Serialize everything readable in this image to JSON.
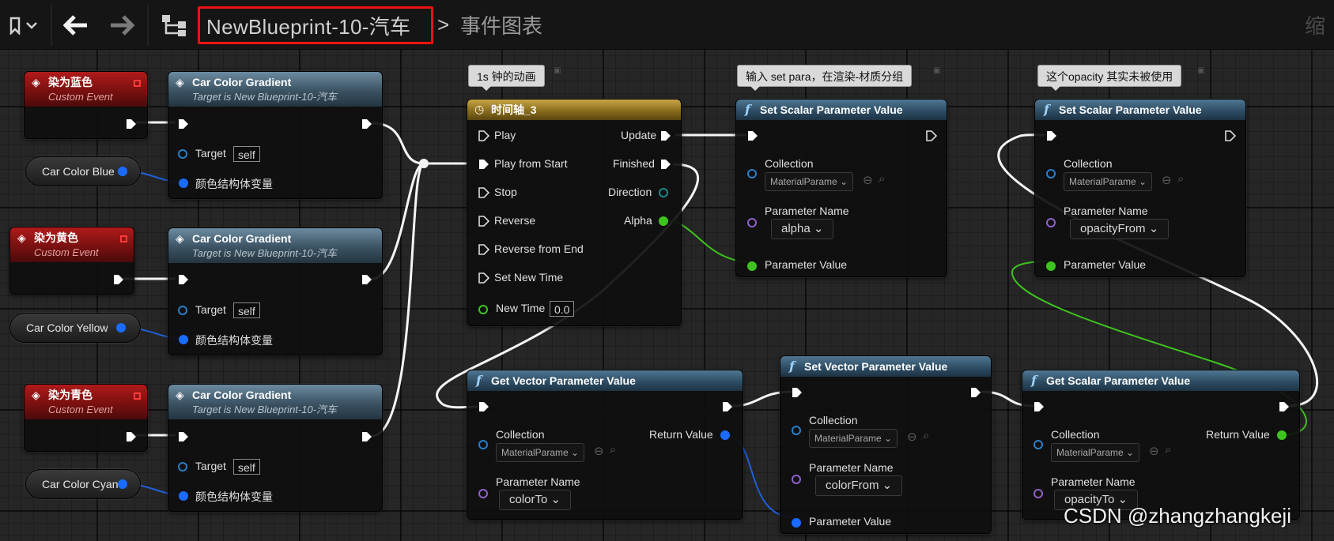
{
  "toolbar": {
    "breadcrumb_current": "NewBlueprint-10-汽车",
    "breadcrumb_separator": ">",
    "breadcrumb_graph": "事件图表",
    "right_truncated": "缩"
  },
  "comments": {
    "timeline": "1s 钟的动画",
    "set_scalar_1": "输入 set para，在渲染-材质分组",
    "set_scalar_2": "这个opacity 其实未被使用"
  },
  "events": [
    {
      "title": "染为蓝色",
      "subtitle": "Custom Event"
    },
    {
      "title": "染为黄色",
      "subtitle": "Custom Event"
    },
    {
      "title": "染为青色",
      "subtitle": "Custom Event"
    }
  ],
  "gradients": [
    {
      "title": "Car Color Gradient",
      "subtitle": "Target is New Blueprint-10-汽车",
      "target_label": "Target",
      "target_value": "self",
      "struct_label": "颜色结构体变量"
    },
    {
      "title": "Car Color Gradient",
      "subtitle": "Target is New Blueprint-10-汽车",
      "target_label": "Target",
      "target_value": "self",
      "struct_label": "颜色结构体变量"
    },
    {
      "title": "Car Color Gradient",
      "subtitle": "Target is New Blueprint-10-汽车",
      "target_label": "Target",
      "target_value": "self",
      "struct_label": "颜色结构体变量"
    }
  ],
  "variables": [
    "Car Color Blue",
    "Car Color Yellow",
    "Car Color Cyan"
  ],
  "timeline": {
    "title": "时间轴_3",
    "inputs": [
      "Play",
      "Play from Start",
      "Stop",
      "Reverse",
      "Reverse from End",
      "Set New Time"
    ],
    "new_time_label": "New Time",
    "new_time_value": "0.0",
    "outputs": [
      "Update",
      "Finished",
      "Direction",
      "Alpha"
    ]
  },
  "set_scalar_1": {
    "title": "Set Scalar Parameter Value",
    "collection_label": "Collection",
    "collection_value": "MaterialParame",
    "param_name_label": "Parameter Name",
    "param_name_value": "alpha",
    "param_value_label": "Parameter Value"
  },
  "set_scalar_2": {
    "title": "Set Scalar Parameter Value",
    "collection_label": "Collection",
    "collection_value": "MaterialParame",
    "param_name_label": "Parameter Name",
    "param_name_value": "opacityFrom",
    "param_value_label": "Parameter Value"
  },
  "get_vector": {
    "title": "Get Vector Parameter Value",
    "collection_label": "Collection",
    "collection_value": "MaterialParame",
    "param_name_label": "Parameter Name",
    "param_name_value": "colorTo",
    "return_label": "Return Value"
  },
  "set_vector": {
    "title": "Set Vector Parameter Value",
    "collection_label": "Collection",
    "collection_value": "MaterialParame",
    "param_name_label": "Parameter Name",
    "param_name_value": "colorFrom",
    "param_value_label": "Parameter Value"
  },
  "get_scalar": {
    "title": "Get Scalar Parameter Value",
    "collection_label": "Collection",
    "collection_value": "MaterialParame",
    "param_name_label": "Parameter Name",
    "param_name_value": "opacityTo",
    "return_label": "Return Value"
  },
  "watermark": "CSDN @zhangzhangkeji",
  "colors": {
    "exec_wire": "#ffffff",
    "struct_wire": "#1f5fd6",
    "float_wire": "#3ec41e",
    "highlight": "#ee1111"
  }
}
